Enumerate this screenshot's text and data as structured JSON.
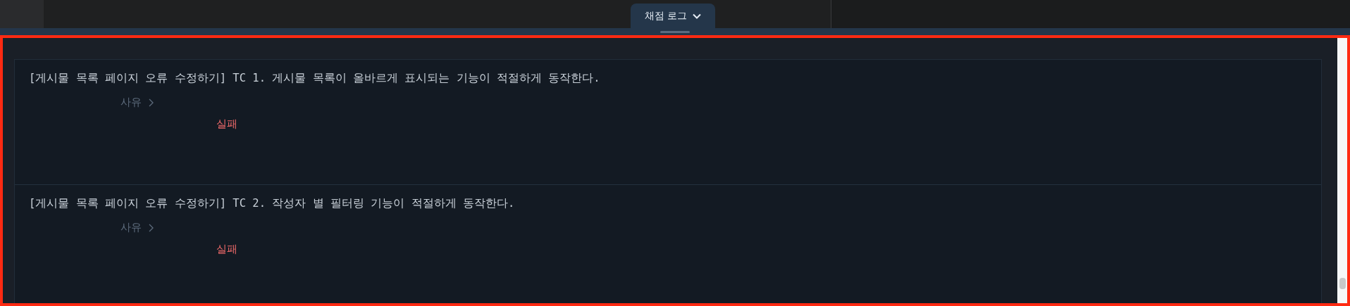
{
  "top_tab": {
    "label": "채점 로그"
  },
  "test_cases": [
    {
      "title": "[게시물 목록 페이지 오류 수정하기] TC 1. 게시물 목록이 올바르게 표시되는 기능이 적절하게 동작한다.",
      "reason_label": "사유",
      "result": "실패"
    },
    {
      "title": "[게시물 목록 페이지 오류 수정하기] TC 2. 작성자 별 필터링 기능이 적절하게 동작한다.",
      "reason_label": "사유",
      "result": "실패"
    }
  ]
}
